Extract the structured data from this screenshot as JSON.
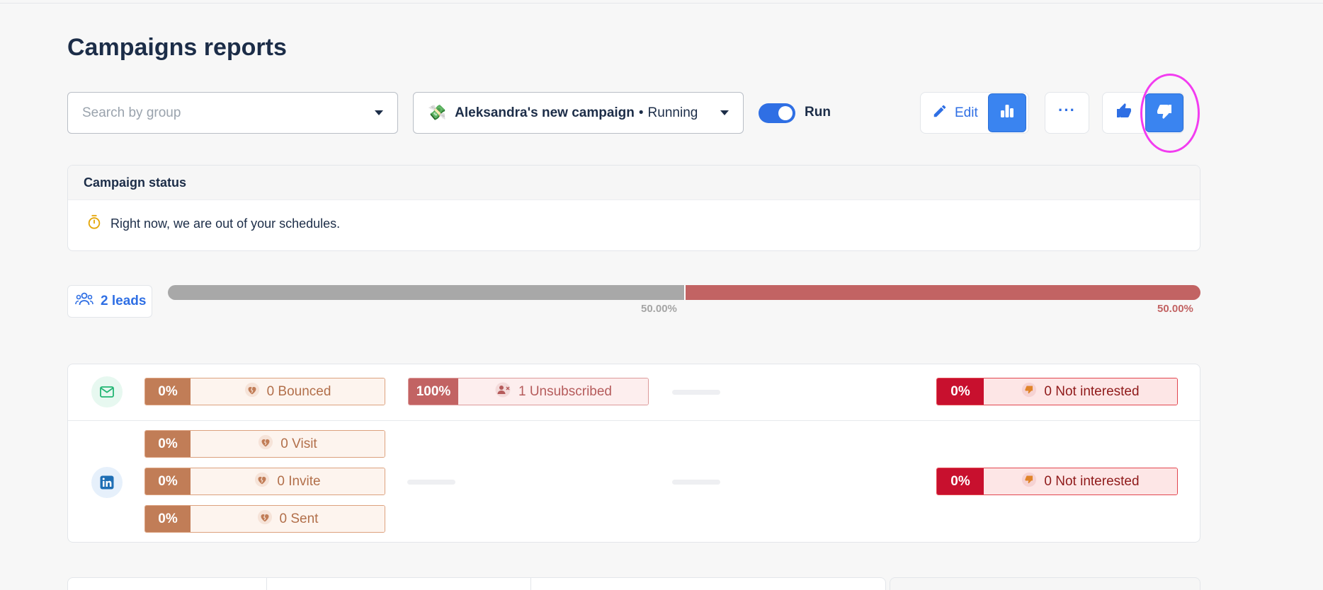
{
  "page": {
    "title": "Campaigns reports"
  },
  "filters": {
    "group_placeholder": "Search by group",
    "campaign_emoji": "💸",
    "campaign_name": "Aleksandra's new campaign",
    "campaign_separator": "•",
    "campaign_status": "Running",
    "run_label": "Run",
    "run_enabled": true
  },
  "toolbar": {
    "edit_label": "Edit",
    "more_label": "···"
  },
  "status_card": {
    "title": "Campaign status",
    "message": "Right now, we are out of your schedules."
  },
  "leads": {
    "label": "2 leads",
    "progress": [
      {
        "label": "50.00%",
        "value": 0.5,
        "color": "#a8a8a8"
      },
      {
        "label": "50.00%",
        "value": 0.5,
        "color": "#c26363"
      }
    ]
  },
  "email_stats": {
    "bounced": {
      "pct": "0%",
      "label": "0 Bounced"
    },
    "unsubscribed": {
      "pct": "100%",
      "label": "1 Unsubscribed"
    },
    "not_interested": {
      "pct": "0%",
      "label": "0 Not interested"
    }
  },
  "linkedin_stats": {
    "visit": {
      "pct": "0%",
      "label": "0 Visit"
    },
    "invite": {
      "pct": "0%",
      "label": "0 Invite"
    },
    "sent": {
      "pct": "0%",
      "label": "0 Sent"
    },
    "not_interested": {
      "pct": "0%",
      "label": "0 Not interested"
    }
  },
  "icons": {
    "search_caret": "chevron-down-icon",
    "edit": "pencil-icon",
    "chart": "bar-chart-icon",
    "thumbs_up": "thumbs-up-icon",
    "thumbs_down": "thumbs-down-icon",
    "timer": "stopwatch-icon",
    "leads": "users-icon",
    "email": "envelope-icon",
    "linkedin": "linkedin-icon",
    "broken_heart": "broken-heart-icon"
  },
  "colors": {
    "accent": "#2f6fe4",
    "danger": "#c8102e",
    "warning": "#c17d57",
    "highlight": "#f23cf0"
  }
}
